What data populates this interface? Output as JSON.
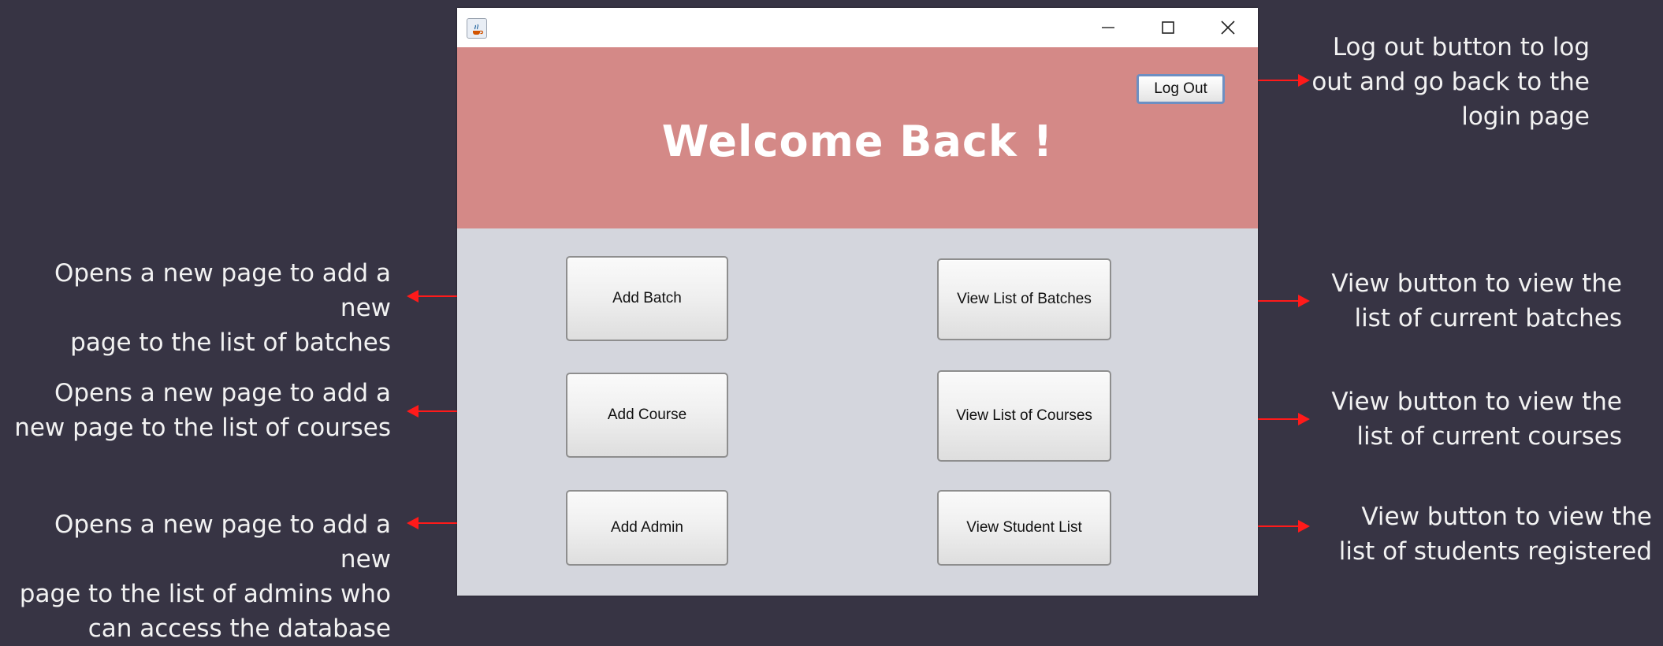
{
  "window": {
    "title": "",
    "header_title": "Welcome Back !",
    "logout_label": "Log Out",
    "buttons": {
      "add_batch": "Add Batch",
      "add_course": "Add Course",
      "add_admin": "Add Admin",
      "view_batches": "View List of Batches",
      "view_courses": "View List of Courses",
      "view_students": "View Student List"
    },
    "icons": [
      "java-icon",
      "minimize-icon",
      "maximize-icon",
      "close-icon"
    ]
  },
  "annotations": {
    "logout": [
      "Log out button to log",
      "out and go back to the",
      "login page"
    ],
    "add_batch": [
      "Opens a new page to add a new",
      "page to the list of batches"
    ],
    "add_course": [
      "Opens a new page to add a",
      "new page to the list of courses"
    ],
    "add_admin": [
      "Opens a new page to add a new",
      "page to the list of admins who",
      "can access the database"
    ],
    "view_batches": [
      "View button to view the",
      "list of current batches"
    ],
    "view_courses": [
      "View button to view the",
      "list of current courses"
    ],
    "view_students": [
      "View button to view the",
      "list of students registered"
    ]
  },
  "colors": {
    "background": "#373444",
    "header": "#d48987",
    "panel": "#d4d6dd",
    "arrow": "#ff1a1a"
  }
}
